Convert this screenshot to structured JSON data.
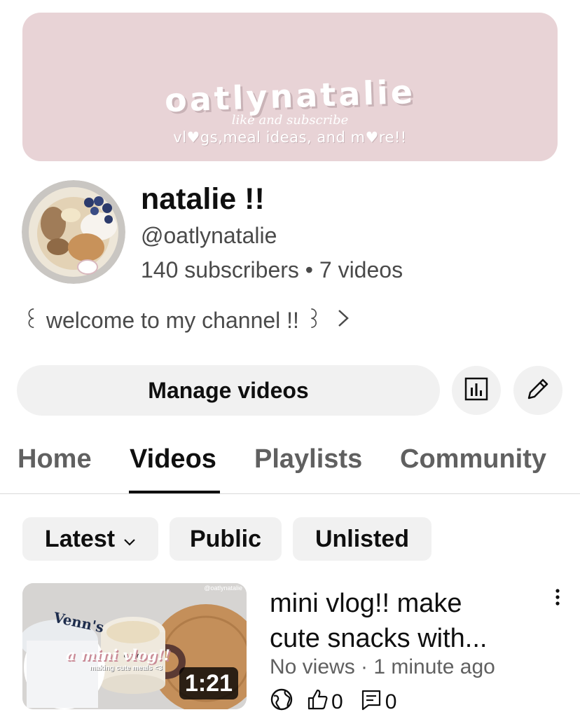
{
  "banner": {
    "title": "oatlynatalie",
    "subtitle": "like and subscribe",
    "description": "vl♥gs,meal ideas, and m♥re!!"
  },
  "channel": {
    "name": "natalie !!",
    "handle": "@oatlynatalie",
    "stats": "140 subscribers • 7 videos",
    "description": "꒰ welcome to my channel !! ꒱"
  },
  "actions": {
    "manage_label": "Manage videos",
    "analytics_icon": "analytics-icon",
    "edit_icon": "pencil-icon"
  },
  "tabs": [
    {
      "label": "Home"
    },
    {
      "label": "Videos"
    },
    {
      "label": "Playlists"
    },
    {
      "label": "Community"
    }
  ],
  "active_tab": "Videos",
  "filters": [
    {
      "label": "Latest"
    },
    {
      "label": "Public"
    },
    {
      "label": "Unlisted"
    }
  ],
  "videos": [
    {
      "title_line1": "mini vlog!! make",
      "title_line2": "cute snacks with...",
      "meta": "No views · 1 minute ago",
      "likes": "0",
      "comments": "0",
      "duration": "1:21",
      "thumb_text": "a mini vlog!!",
      "thumb_subtext": "making cute meals <3",
      "thumb_brand": "Venn's",
      "thumb_watermark": "@oatlynatalie"
    }
  ],
  "colors": {
    "banner_bg": "#e8d3d6",
    "chip_bg": "#f1f1f1",
    "text_primary": "#0f0f0f",
    "text_secondary": "#606060"
  }
}
